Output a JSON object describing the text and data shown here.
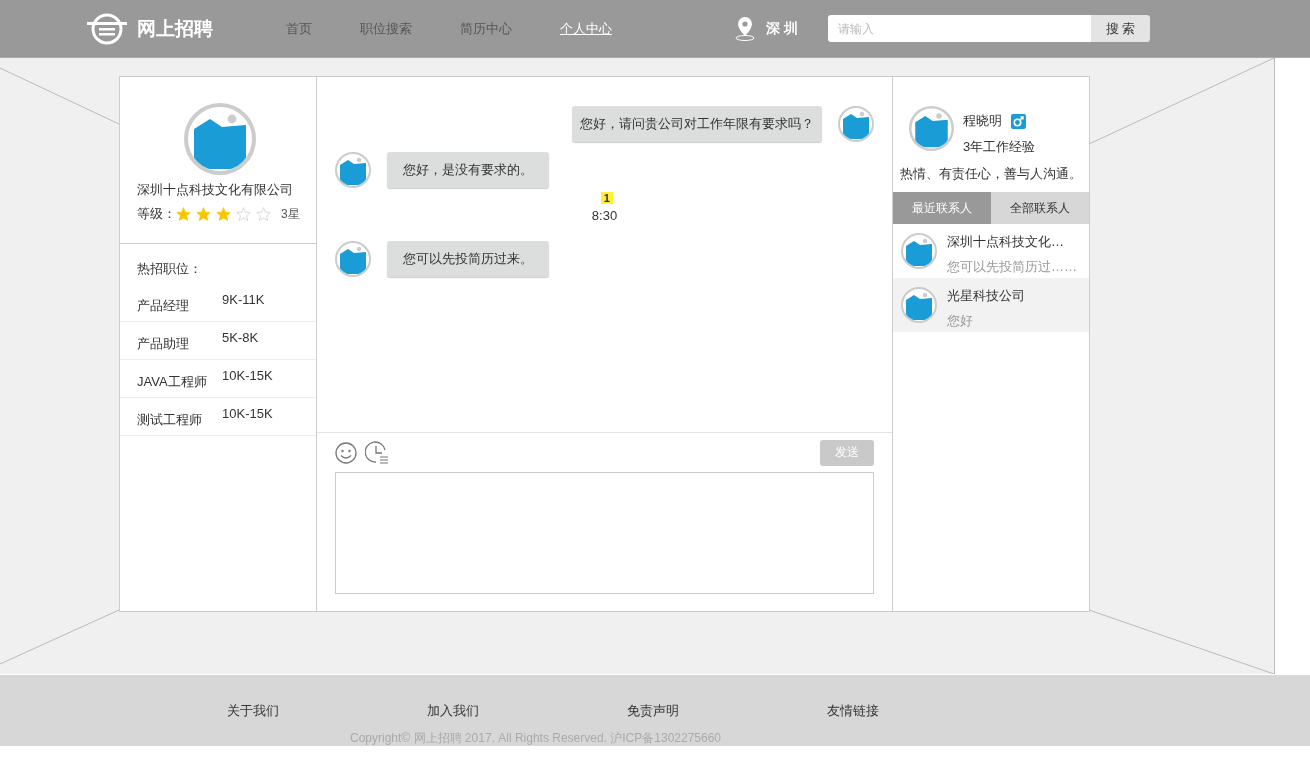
{
  "header": {
    "logo": "网上招聘",
    "nav": [
      {
        "label": "首页",
        "selected": false
      },
      {
        "label": "职位搜索",
        "selected": false
      },
      {
        "label": "简历中心",
        "selected": false
      },
      {
        "label": "个人中心",
        "selected": true
      }
    ],
    "city": "深 圳",
    "search": {
      "placeholder": "请输入",
      "button": "搜 索"
    }
  },
  "company": {
    "name": "深圳十点科技文化有限公司",
    "level_label": "等级：",
    "stars": 3,
    "rating": "3星",
    "jobs_title": "热招职位：",
    "jobs": [
      {
        "title": "产品经理",
        "salary": "9K-11K"
      },
      {
        "title": "产品助理",
        "salary": "5K-8K"
      },
      {
        "title": "JAVA工程师",
        "salary": "10K-15K"
      },
      {
        "title": "测试工程师",
        "salary": "10K-15K"
      }
    ]
  },
  "chat": {
    "messages": [
      {
        "kind": "sent",
        "text": "您好，请问贵公司对工作年限有要求吗？"
      },
      {
        "kind": "received",
        "text": "您好，是没有要求的。"
      },
      {
        "kind": "time",
        "text": "8:30",
        "badge": "1"
      },
      {
        "kind": "received",
        "text": "您可以先投简历过来。"
      }
    ],
    "send_button": "发送"
  },
  "profile": {
    "name": "程晓明",
    "experience": "3年工作经验",
    "bio": "热情、有责任心，善与人沟通。"
  },
  "contact_tabs": [
    {
      "label": "最近联系人",
      "selected": true
    },
    {
      "label": "全部联系人",
      "selected": false
    }
  ],
  "contacts": [
    {
      "name": "深圳十点科技文化…",
      "preview": "您可以先投简历过……",
      "selected": false
    },
    {
      "name": "光星科技公司",
      "preview": "您好",
      "selected": true
    }
  ],
  "footer": {
    "links": [
      "关于我们",
      "加入我们",
      "免责声明",
      "友情链接"
    ],
    "copyright": "Copyright© 网上招聘 2017. All Rights Reserved. 沪ICP备1302275660"
  }
}
